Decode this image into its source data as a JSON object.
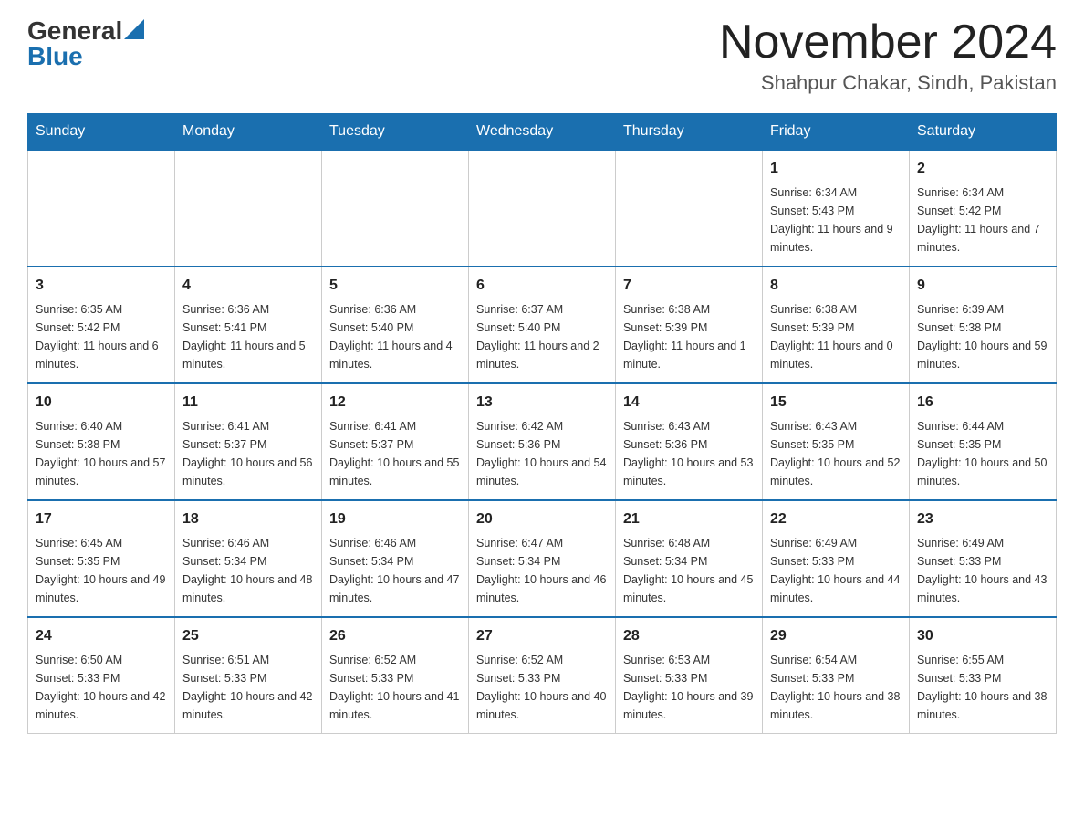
{
  "header": {
    "logo_general": "General",
    "logo_blue": "Blue",
    "title": "November 2024",
    "location": "Shahpur Chakar, Sindh, Pakistan"
  },
  "days_of_week": [
    "Sunday",
    "Monday",
    "Tuesday",
    "Wednesday",
    "Thursday",
    "Friday",
    "Saturday"
  ],
  "weeks": [
    [
      {
        "day": "",
        "info": ""
      },
      {
        "day": "",
        "info": ""
      },
      {
        "day": "",
        "info": ""
      },
      {
        "day": "",
        "info": ""
      },
      {
        "day": "",
        "info": ""
      },
      {
        "day": "1",
        "info": "Sunrise: 6:34 AM\nSunset: 5:43 PM\nDaylight: 11 hours and 9 minutes."
      },
      {
        "day": "2",
        "info": "Sunrise: 6:34 AM\nSunset: 5:42 PM\nDaylight: 11 hours and 7 minutes."
      }
    ],
    [
      {
        "day": "3",
        "info": "Sunrise: 6:35 AM\nSunset: 5:42 PM\nDaylight: 11 hours and 6 minutes."
      },
      {
        "day": "4",
        "info": "Sunrise: 6:36 AM\nSunset: 5:41 PM\nDaylight: 11 hours and 5 minutes."
      },
      {
        "day": "5",
        "info": "Sunrise: 6:36 AM\nSunset: 5:40 PM\nDaylight: 11 hours and 4 minutes."
      },
      {
        "day": "6",
        "info": "Sunrise: 6:37 AM\nSunset: 5:40 PM\nDaylight: 11 hours and 2 minutes."
      },
      {
        "day": "7",
        "info": "Sunrise: 6:38 AM\nSunset: 5:39 PM\nDaylight: 11 hours and 1 minute."
      },
      {
        "day": "8",
        "info": "Sunrise: 6:38 AM\nSunset: 5:39 PM\nDaylight: 11 hours and 0 minutes."
      },
      {
        "day": "9",
        "info": "Sunrise: 6:39 AM\nSunset: 5:38 PM\nDaylight: 10 hours and 59 minutes."
      }
    ],
    [
      {
        "day": "10",
        "info": "Sunrise: 6:40 AM\nSunset: 5:38 PM\nDaylight: 10 hours and 57 minutes."
      },
      {
        "day": "11",
        "info": "Sunrise: 6:41 AM\nSunset: 5:37 PM\nDaylight: 10 hours and 56 minutes."
      },
      {
        "day": "12",
        "info": "Sunrise: 6:41 AM\nSunset: 5:37 PM\nDaylight: 10 hours and 55 minutes."
      },
      {
        "day": "13",
        "info": "Sunrise: 6:42 AM\nSunset: 5:36 PM\nDaylight: 10 hours and 54 minutes."
      },
      {
        "day": "14",
        "info": "Sunrise: 6:43 AM\nSunset: 5:36 PM\nDaylight: 10 hours and 53 minutes."
      },
      {
        "day": "15",
        "info": "Sunrise: 6:43 AM\nSunset: 5:35 PM\nDaylight: 10 hours and 52 minutes."
      },
      {
        "day": "16",
        "info": "Sunrise: 6:44 AM\nSunset: 5:35 PM\nDaylight: 10 hours and 50 minutes."
      }
    ],
    [
      {
        "day": "17",
        "info": "Sunrise: 6:45 AM\nSunset: 5:35 PM\nDaylight: 10 hours and 49 minutes."
      },
      {
        "day": "18",
        "info": "Sunrise: 6:46 AM\nSunset: 5:34 PM\nDaylight: 10 hours and 48 minutes."
      },
      {
        "day": "19",
        "info": "Sunrise: 6:46 AM\nSunset: 5:34 PM\nDaylight: 10 hours and 47 minutes."
      },
      {
        "day": "20",
        "info": "Sunrise: 6:47 AM\nSunset: 5:34 PM\nDaylight: 10 hours and 46 minutes."
      },
      {
        "day": "21",
        "info": "Sunrise: 6:48 AM\nSunset: 5:34 PM\nDaylight: 10 hours and 45 minutes."
      },
      {
        "day": "22",
        "info": "Sunrise: 6:49 AM\nSunset: 5:33 PM\nDaylight: 10 hours and 44 minutes."
      },
      {
        "day": "23",
        "info": "Sunrise: 6:49 AM\nSunset: 5:33 PM\nDaylight: 10 hours and 43 minutes."
      }
    ],
    [
      {
        "day": "24",
        "info": "Sunrise: 6:50 AM\nSunset: 5:33 PM\nDaylight: 10 hours and 42 minutes."
      },
      {
        "day": "25",
        "info": "Sunrise: 6:51 AM\nSunset: 5:33 PM\nDaylight: 10 hours and 42 minutes."
      },
      {
        "day": "26",
        "info": "Sunrise: 6:52 AM\nSunset: 5:33 PM\nDaylight: 10 hours and 41 minutes."
      },
      {
        "day": "27",
        "info": "Sunrise: 6:52 AM\nSunset: 5:33 PM\nDaylight: 10 hours and 40 minutes."
      },
      {
        "day": "28",
        "info": "Sunrise: 6:53 AM\nSunset: 5:33 PM\nDaylight: 10 hours and 39 minutes."
      },
      {
        "day": "29",
        "info": "Sunrise: 6:54 AM\nSunset: 5:33 PM\nDaylight: 10 hours and 38 minutes."
      },
      {
        "day": "30",
        "info": "Sunrise: 6:55 AM\nSunset: 5:33 PM\nDaylight: 10 hours and 38 minutes."
      }
    ]
  ]
}
